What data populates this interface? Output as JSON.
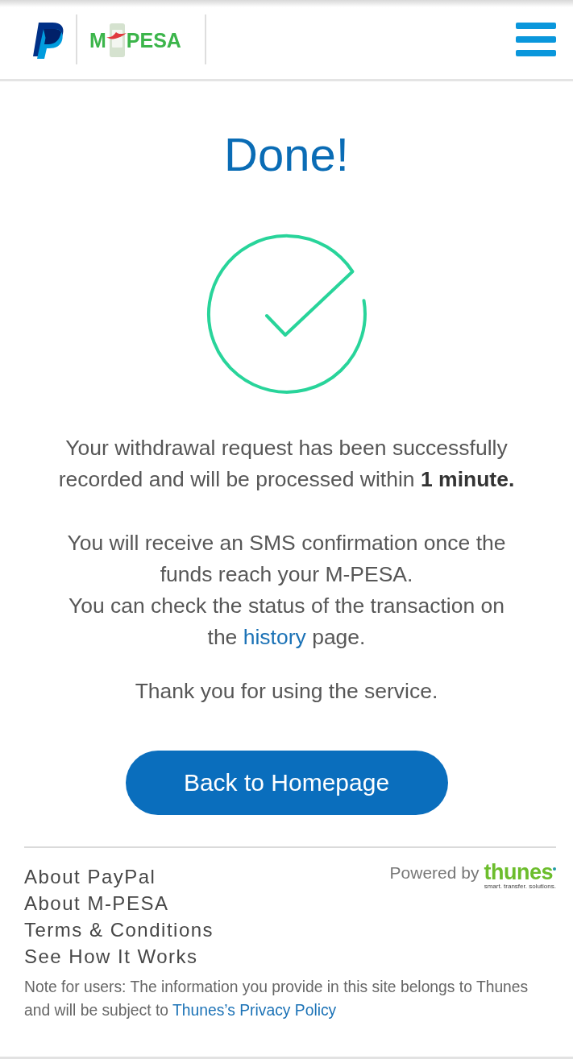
{
  "header": {
    "mpesa_logo": {
      "left": "M",
      "right": "PESA"
    }
  },
  "title": "Done!",
  "summary": "Your withdrawal request has been successfully recorded and will be processed within **1 minute.**",
  "details": [
    {
      "text": "You will receive an SMS confirmation once the funds reach your M-PESA."
    },
    {
      "text": "You can check the status of the transaction on the ",
      "link": "history",
      "after": " page."
    }
  ],
  "thanks": "Thank you for using the service.",
  "button": {
    "label": "Back to Homepage"
  },
  "footer": {
    "links": [
      "About PayPal",
      "About M-PESA",
      "Terms & Conditions",
      "See How It Works"
    ],
    "powered_by": {
      "label": "Powered by",
      "logo": "thunes",
      "tagline": "smart. transfer. solutions."
    },
    "note": {
      "text": "Note for users: The information you provide in this site belongs to Thunes and will be subject to ",
      "link": "Thunes’s Privacy Policy"
    }
  }
}
